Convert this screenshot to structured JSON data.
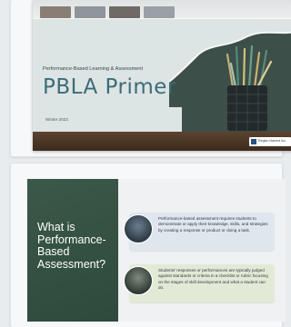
{
  "slide1": {
    "subtitle": "Performance-Based Learning & Assessment",
    "title": "PBLA Primer",
    "date": "Winter 2023",
    "logo_text": "Region Named Inc."
  },
  "slide2": {
    "title_lines": [
      "What is",
      "Performance-",
      "Based",
      "Assessment?"
    ],
    "cards": [
      {
        "text": "Performance-based assessment requires students to demonstrate or apply their knowledge, skills, and strategies by creating a response or product or doing a task."
      },
      {
        "text": "Students’ responses or performances are typically judged against standards or criteria in a checklist or rubric focusing on the stages of skill development and what a student can do."
      }
    ]
  },
  "colors": {
    "chalkboard": "#3c4f48",
    "title_teal": "#3c6b78",
    "card_blue": "#dfe6ee",
    "card_green": "#e2ead6"
  }
}
